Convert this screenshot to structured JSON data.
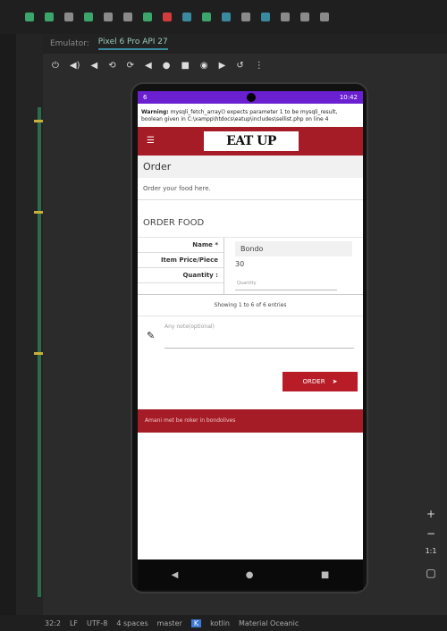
{
  "ide": {
    "tabs": [
      "Emulator:",
      "Pixel 6 Pro API 27"
    ],
    "statusbar": {
      "position": "32:2",
      "lf": "LF",
      "encoding": "UTF-8",
      "indent": "4 spaces",
      "branch": "master",
      "lang": "K",
      "kotlin": "kotlin",
      "theme": "Material Oceanic"
    }
  },
  "phone": {
    "status_left": "6",
    "status_right": "10:42",
    "warning": {
      "label": "Warning:",
      "text": "mysqli_fetch_array() expects parameter 1 to be mysqli_result, boolean given in C:\\xampp\\htdocs\\eatup\\includes\\sellist.php on line 4"
    },
    "logo": "EAT UP",
    "order_title": "Order",
    "order_desc": "Order your food here.",
    "order_food_title": "ORDER FOOD",
    "form": {
      "name_label": "Name *",
      "price_label": "Item Price/Piece",
      "qty_label": "Quantity :",
      "name_value": "Bondo",
      "price_value": "30",
      "qty_placeholder": "Quantity"
    },
    "entries_text": "Showing 1 to 6 of 6 entries",
    "note_placeholder": "Any note(optional)",
    "order_button": "ORDER",
    "footer_text": "Amani met be roker in bondolives"
  }
}
